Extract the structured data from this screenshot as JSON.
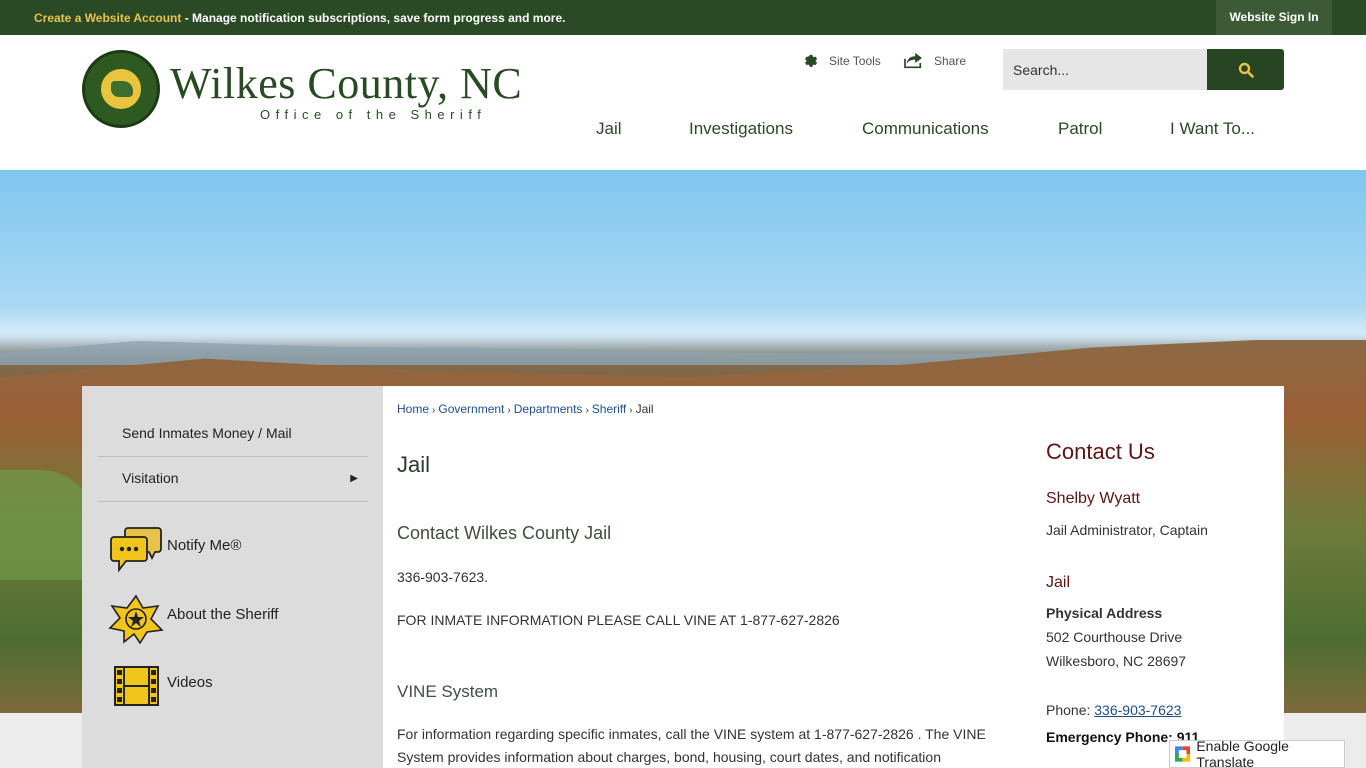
{
  "topbar": {
    "create_account": "Create a Website Account",
    "message": " - Manage notification subscriptions, save form progress and more.",
    "sign_in": "Website Sign In"
  },
  "header": {
    "logo_title": "Wilkes County, NC",
    "logo_subtitle": "Office of the Sheriff",
    "site_tools": "Site Tools",
    "share": "Share",
    "search_placeholder": "Search..."
  },
  "nav": [
    "Jail",
    "Investigations",
    "Communications",
    "Patrol",
    "I Want To..."
  ],
  "sidebar": {
    "links": [
      {
        "label": "Send Inmates Money / Mail",
        "has_arrow": false
      },
      {
        "label": "Visitation",
        "has_arrow": true
      }
    ],
    "arrow_glyph": "▶",
    "quick_links": [
      {
        "label": "Notify Me®",
        "icon": "chat-bubbles-icon"
      },
      {
        "label": "About the Sheriff",
        "icon": "sheriff-badge-icon"
      },
      {
        "label": "Videos",
        "icon": "film-strip-icon"
      }
    ]
  },
  "breadcrumb": {
    "items": [
      "Home",
      "Government",
      "Departments",
      "Sheriff"
    ],
    "current": "Jail",
    "separator": "›"
  },
  "main": {
    "title": "Jail",
    "section1_heading": "Contact Wilkes County Jail",
    "phone_line": " 336-903-7623.",
    "vine_line": "FOR INMATE INFORMATION PLEASE CALL VINE AT 1-877-627-2826",
    "section2_heading": "VINE System",
    "vine_paragraph": "For information regarding specific inmates, call the VINE system at 1-877-627-2826 . The VINE System provides information about charges, bond, housing, court dates, and notification"
  },
  "contact": {
    "title": "Contact Us",
    "name": "Shelby Wyatt",
    "role": "Jail Administrator, Captain",
    "dept": "Jail",
    "address_label": "Physical Address",
    "address1": "502 Courthouse Drive",
    "address2": "Wilkesboro, NC 28697",
    "phone_label": "Phone: ",
    "phone": "336-903-7623",
    "emergency": "Emergency Phone: 911"
  },
  "translate": {
    "label": "Enable Google Translate"
  },
  "colors": {
    "brand_green": "#2a4a25",
    "accent_gold": "#e8c34a",
    "contact_maroon": "#5e1414",
    "link_blue": "#1f4f8a"
  }
}
